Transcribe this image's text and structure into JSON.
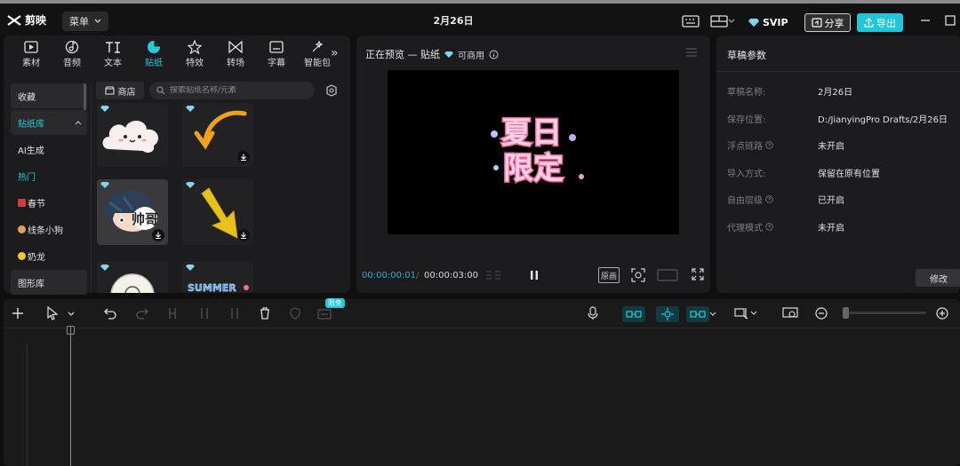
{
  "app": {
    "name": "剪映",
    "menu_label": "菜单",
    "title": "2月26日"
  },
  "header": {
    "svip_label": "SVIP",
    "share_label": "分享",
    "export_label": "导出"
  },
  "category_tabs": [
    {
      "label": "素材",
      "icon": "media-icon"
    },
    {
      "label": "音频",
      "icon": "audio-icon"
    },
    {
      "label": "文本",
      "icon": "text-icon"
    },
    {
      "label": "贴纸",
      "icon": "sticker-icon",
      "active": true
    },
    {
      "label": "特效",
      "icon": "effects-icon"
    },
    {
      "label": "转场",
      "icon": "transition-icon"
    },
    {
      "label": "字幕",
      "icon": "subtitle-icon"
    },
    {
      "label": "智能包",
      "icon": "smart-icon"
    }
  ],
  "sidebar": {
    "items": [
      {
        "label": "收藏"
      },
      {
        "label": "贴纸库"
      },
      {
        "label": "AI生成"
      },
      {
        "label": "热门"
      },
      {
        "label": "春节"
      },
      {
        "label": "线条小狗"
      },
      {
        "label": "奶龙"
      },
      {
        "label": "图形库"
      }
    ]
  },
  "library": {
    "store_label": "商店",
    "search_placeholder": "搜索贴纸名称/元素",
    "stickers": [
      {
        "name": "cloud-face",
        "downloadable": false
      },
      {
        "name": "yellow-arrow-curve",
        "downloadable": true
      },
      {
        "name": "cool-boy",
        "text": "帅哥",
        "downloadable": true
      },
      {
        "name": "yellow-arrow-down",
        "downloadable": true
      },
      {
        "name": "round-badge",
        "downloadable": false
      },
      {
        "name": "summer-text",
        "text": "SUMMER",
        "downloadable": false
      }
    ]
  },
  "preview": {
    "title": "正在预览 — 贴纸",
    "commercial_label": "可商用",
    "sticker_text_line1": "夏日",
    "sticker_text_line2": "限定",
    "current_time": "00:00:00:01",
    "total_time": "00:00:03:00",
    "original_label": "原画"
  },
  "draft": {
    "title": "草稿参数",
    "props": [
      {
        "label": "草稿名称:",
        "value": "2月26日",
        "info": false
      },
      {
        "label": "保存位置:",
        "value": "D:/JianyingPro Drafts/2月26日",
        "info": false
      },
      {
        "label": "浮点链路",
        "value": "未开启",
        "info": true
      },
      {
        "label": "导入方式:",
        "value": "保留在原有位置",
        "info": false
      },
      {
        "label": "自由层级",
        "value": "已开启",
        "info": true
      },
      {
        "label": "代理模式",
        "value": "未开启",
        "info": true
      }
    ],
    "modify_label": "修改"
  },
  "timeline": {
    "free_badge": "限免"
  },
  "colors": {
    "accent": "#1fc7d8",
    "background": "#0f0f0f",
    "panel": "#1c1c1e"
  }
}
